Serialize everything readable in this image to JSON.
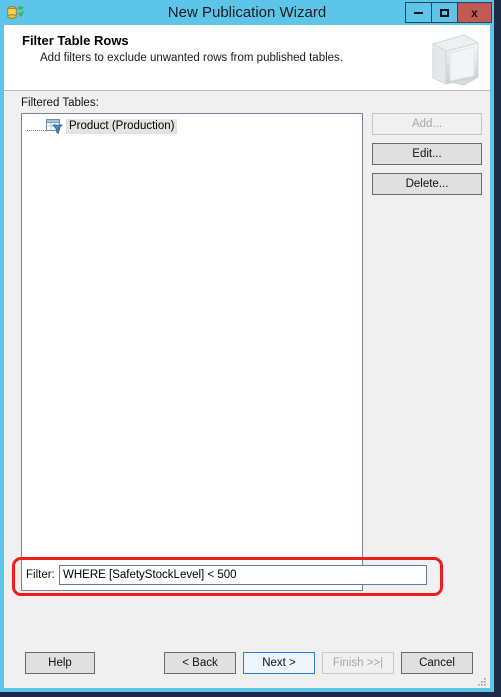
{
  "window": {
    "title": "New Publication Wizard",
    "app_icon": "replication-database-icon",
    "frame_color": "#5ec5ea",
    "desktop_color": "#1e2b45",
    "controls": [
      {
        "name": "minimize",
        "glyph": "minimize-icon",
        "label": ""
      },
      {
        "name": "maximize",
        "glyph": "maximize-icon",
        "label": ""
      },
      {
        "name": "close",
        "glyph": "close-icon",
        "label": "x",
        "color": "#c05a52"
      }
    ]
  },
  "header": {
    "title": "Filter Table Rows",
    "subtitle": "Add filters to exclude unwanted rows from published tables.",
    "art_icon": "book-binder-icon"
  },
  "main": {
    "filtered_tables_label": "Filtered Tables:",
    "tree": {
      "items": [
        {
          "label": "Product (Production)",
          "icon": "table-filter-icon",
          "selected": true
        }
      ]
    },
    "side_buttons": [
      {
        "name": "add-button",
        "label": "Add...",
        "disabled": true
      },
      {
        "name": "edit-button",
        "label": "Edit...",
        "disabled": false
      },
      {
        "name": "delete-button",
        "label": "Delete...",
        "disabled": false
      }
    ]
  },
  "filter": {
    "label": "Filter:",
    "value": "WHERE [SafetyStockLevel] < 500",
    "placeholder": "",
    "highlight_color": "#ee1c1c",
    "caret_at_start": true
  },
  "footer": {
    "buttons": [
      {
        "name": "help-button",
        "label": "Help",
        "state": "normal"
      },
      {
        "name": "back-button",
        "label": "< Back",
        "state": "normal"
      },
      {
        "name": "next-button",
        "label": "Next >",
        "state": "focused"
      },
      {
        "name": "finish-button",
        "label": "Finish >>|",
        "state": "disabled"
      },
      {
        "name": "cancel-button",
        "label": "Cancel",
        "state": "normal"
      }
    ],
    "resize_grip": "resize-grip-icon"
  }
}
